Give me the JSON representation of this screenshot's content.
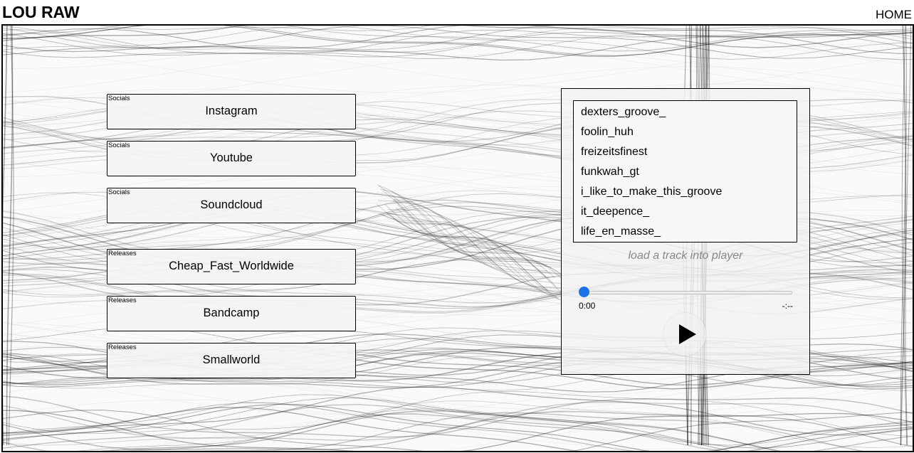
{
  "header": {
    "brand": "LOU RAW",
    "nav_home": "HOME"
  },
  "links": [
    {
      "tag": "Socials",
      "label": "Instagram"
    },
    {
      "tag": "Socials",
      "label": "Youtube"
    },
    {
      "tag": "Socials",
      "label": "Soundcloud"
    },
    {
      "tag": "Releases",
      "label": "Cheap_Fast_Worldwide"
    },
    {
      "tag": "Releases",
      "label": "Bandcamp"
    },
    {
      "tag": "Releases",
      "label": "Smallworld"
    }
  ],
  "player": {
    "tracks": [
      "dexters_groove_",
      "foolin_huh",
      "freizeitsfinest",
      "funkwah_gt",
      "i_like_to_make_this_groove",
      "it_deepence_",
      "life_en_masse_"
    ],
    "hint": "load a track into player",
    "time_current": "0:00",
    "time_total": "-:--",
    "progress": 0,
    "play_icon": "play-icon"
  },
  "colors": {
    "accent": "#1a73e8",
    "hint_text": "#888888",
    "panel_bg": "#f3f3f3"
  }
}
